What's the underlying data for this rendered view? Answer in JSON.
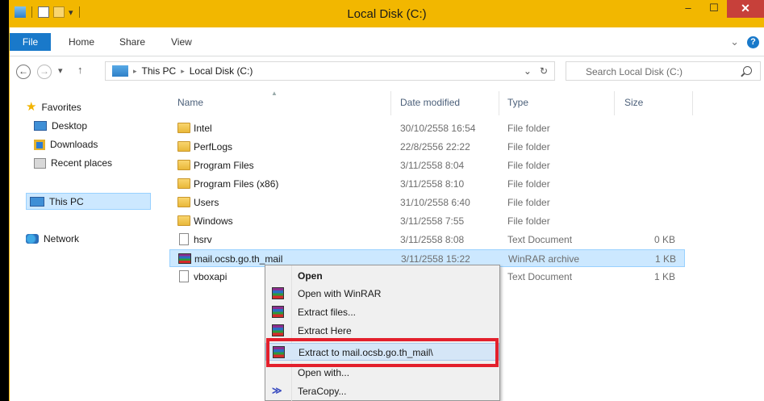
{
  "window": {
    "title": "Local Disk (C:)",
    "minimize_glyph": "–",
    "maximize_glyph": "☐",
    "close_glyph": "✕"
  },
  "ribbon": {
    "tabs": [
      "File",
      "Home",
      "Share",
      "View"
    ],
    "expand_glyph": "⌄",
    "help_glyph": "?"
  },
  "navigation": {
    "back_glyph": "←",
    "forward_glyph": "→",
    "recent_glyph": "▾",
    "up_glyph": "↑",
    "breadcrumb": [
      "This PC",
      "Local Disk (C:)"
    ],
    "crumb_sep": "▸",
    "dropdown_glyph": "⌄",
    "refresh_glyph": "↻",
    "search_placeholder": "Search Local Disk (C:)"
  },
  "nav_pane": {
    "favorites": "Favorites",
    "desktop": "Desktop",
    "downloads": "Downloads",
    "recent_places": "Recent places",
    "this_pc": "This PC",
    "network": "Network"
  },
  "columns": {
    "name": "Name",
    "date_modified": "Date modified",
    "type": "Type",
    "size": "Size",
    "sort_glyph": "▲"
  },
  "files": [
    {
      "name": "Intel",
      "date": "30/10/2558 16:54",
      "type": "File folder",
      "size": "",
      "icon": "folder"
    },
    {
      "name": "PerfLogs",
      "date": "22/8/2556 22:22",
      "type": "File folder",
      "size": "",
      "icon": "folder"
    },
    {
      "name": "Program Files",
      "date": "3/11/2558 8:04",
      "type": "File folder",
      "size": "",
      "icon": "folder"
    },
    {
      "name": "Program Files (x86)",
      "date": "3/11/2558 8:10",
      "type": "File folder",
      "size": "",
      "icon": "folder"
    },
    {
      "name": "Users",
      "date": "31/10/2558 6:40",
      "type": "File folder",
      "size": "",
      "icon": "folder"
    },
    {
      "name": "Windows",
      "date": "3/11/2558 7:55",
      "type": "File folder",
      "size": "",
      "icon": "folder"
    },
    {
      "name": "hsrv",
      "date": "3/11/2558 8:08",
      "type": "Text Document",
      "size": "0 KB",
      "icon": "document"
    },
    {
      "name": "mail.ocsb.go.th_mail",
      "date": "3/11/2558 15:22",
      "type": "WinRAR archive",
      "size": "1 KB",
      "icon": "winrar"
    },
    {
      "name": "vboxapi",
      "date": "",
      "type": "Text Document",
      "size": "1 KB",
      "icon": "document"
    }
  ],
  "context_menu": {
    "items": [
      {
        "label": "Open",
        "icon": "none"
      },
      {
        "label": "Open with WinRAR",
        "icon": "winrar"
      },
      {
        "label": "Extract files...",
        "icon": "winrar"
      },
      {
        "label": "Extract Here",
        "icon": "winrar"
      },
      {
        "label": "Extract to mail.ocsb.go.th_mail\\",
        "icon": "winrar"
      },
      {
        "label": "Open with...",
        "icon": "none"
      },
      {
        "label": "TeraCopy...",
        "icon": "teracopy"
      }
    ],
    "teracopy_glyph": "≫"
  },
  "colors": {
    "title_bar": "#f2b700",
    "file_tab": "#1979ca",
    "close_button": "#c7403a",
    "selection": "#cce8ff",
    "highlight_box": "#e3202c"
  }
}
